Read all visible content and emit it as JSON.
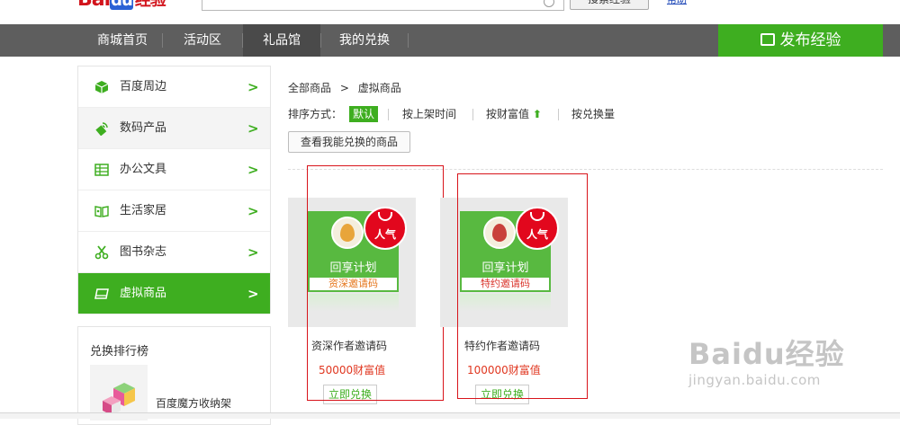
{
  "header": {
    "logo_bai": "Bai",
    "logo_du": "du",
    "logo_jingyan": "经验",
    "search_button": "搜索经验",
    "help": "帮助"
  },
  "nav": {
    "items": [
      "商城首页",
      "活动区",
      "礼品馆",
      "我的兑换"
    ],
    "publish": "发布经验"
  },
  "sidebar": {
    "items": [
      {
        "label": "百度周边",
        "icon": "cube-icon"
      },
      {
        "label": "数码产品",
        "icon": "usb-icon"
      },
      {
        "label": "办公文具",
        "icon": "table-icon"
      },
      {
        "label": "生活家居",
        "icon": "book-open-icon"
      },
      {
        "label": "图书杂志",
        "icon": "scissors-icon"
      },
      {
        "label": "虚拟商品",
        "icon": "card-icon"
      }
    ],
    "chevron": ">",
    "active_index": 5
  },
  "rank": {
    "title": "兑换排行榜",
    "item": "百度魔方收纳架"
  },
  "breadcrumb": {
    "all": "全部商品",
    "sep": ">",
    "current": "虚拟商品"
  },
  "sort": {
    "label": "排序方式：",
    "default": "默认",
    "by_time": "按上架时间",
    "by_wealth": "按财富值",
    "by_wealth_arrow": "⬆",
    "by_count": "按兑换量"
  },
  "filter_button": "查看我能兑换的商品",
  "products": [
    {
      "plan": "回享计划",
      "code": "资深邀请码",
      "name": "资深作者邀请码",
      "price": "50000财富值",
      "button": "立即兑换",
      "hot": "人气",
      "code_color": "#e5761d",
      "medal_color": "#e8a53a"
    },
    {
      "plan": "回享计划",
      "code": "特约邀请码",
      "name": "特约作者邀请码",
      "price": "100000财富值",
      "button": "立即兑换",
      "hot": "人气",
      "code_color": "#d9342b",
      "medal_color": "#c9413b"
    }
  ],
  "watermark": {
    "main": "Baidu经验",
    "sub": "jingyan.baidu.com"
  },
  "colors": {
    "accent": "#3eae20",
    "nav_bg": "#5e5e5e",
    "price": "#e0361f",
    "badge": "#e2071d"
  }
}
